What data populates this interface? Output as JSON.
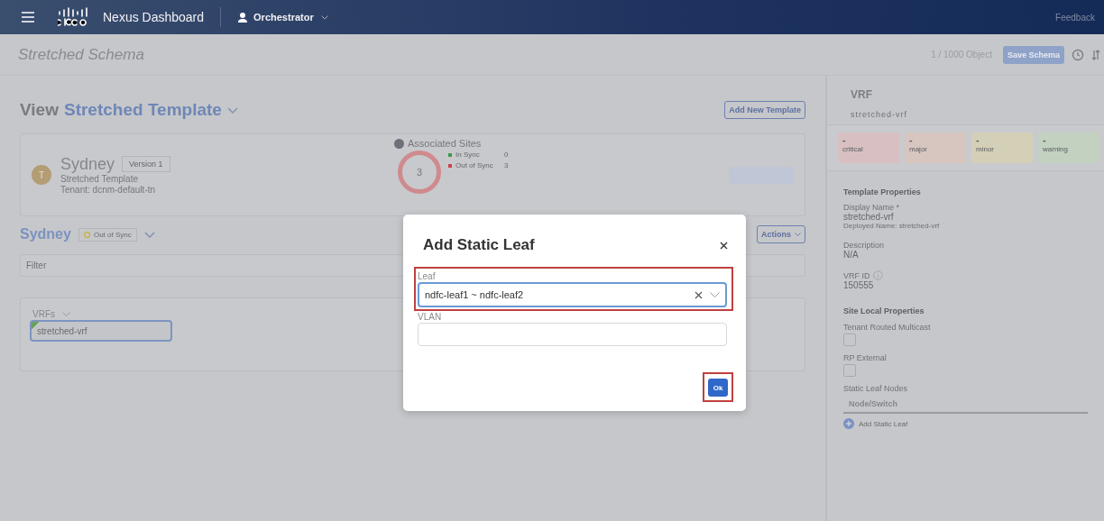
{
  "header": {
    "app_name": "Nexus Dashboard",
    "service": "Orchestrator",
    "feedback": "Feedback"
  },
  "toolbar": {
    "title": "Stretched Schema",
    "object_count": "1 / 1000 Object",
    "save_button": "Save Schema"
  },
  "view": {
    "label": "View",
    "template": "Stretched Template",
    "add_button": "Add New Template"
  },
  "template_card": {
    "avatar": "T",
    "name": "Sydney",
    "version": "Version 1",
    "subtitle": "Stretched Template",
    "tenant": "Tenant: dcnm-default-tn",
    "sites_title": "Associated Sites",
    "sites_total": "3",
    "legend": [
      {
        "label": "In Sync",
        "count": "0",
        "color": "#3a9a4a"
      },
      {
        "label": "Out of Sync",
        "count": "3",
        "color": "#d0404a"
      }
    ]
  },
  "site": {
    "name": "Sydney",
    "status": "Out of Sync",
    "actions": "Actions",
    "filter_placeholder": "Filter"
  },
  "vrfs": {
    "title": "VRFs",
    "items": [
      {
        "name": "stretched-vrf",
        "selected": true
      }
    ]
  },
  "right_panel": {
    "title": "VRF",
    "subtitle": "stretched-vrf",
    "severities": [
      {
        "value": "-",
        "label": "critical",
        "color": "#d8c0c2"
      },
      {
        "value": "-",
        "label": "major",
        "color": "#d6c6bf"
      },
      {
        "value": "-",
        "label": "minor",
        "color": "#d4d0b8"
      },
      {
        "value": "-",
        "label": "warning",
        "color": "#c3d1c0"
      }
    ],
    "template_properties": "Template Properties",
    "display_name_label": "Display Name *",
    "display_name": "stretched-vrf",
    "deployed_name": "Deployed Name: stretched-vrf",
    "description_label": "Description",
    "description": "N/A",
    "vrf_id_label": "VRF ID",
    "vrf_id": "150555",
    "site_local_properties": "Site Local Properties",
    "checkboxes": [
      {
        "label": "Tenant Routed Multicast",
        "checked": false
      },
      {
        "label": "RP External",
        "checked": false
      }
    ],
    "static_leaf_label": "Static Leaf Nodes",
    "node_column": "Node/Switch",
    "add_static_leaf": "Add Static Leaf"
  },
  "dialog": {
    "title": "Add Static Leaf",
    "leaf_label": "Leaf",
    "leaf_value": "ndfc-leaf1 ~ ndfc-leaf2",
    "leaf_highlighted": true,
    "vlan_label": "VLAN",
    "ok_button": "Ok",
    "ok_highlighted": true
  }
}
